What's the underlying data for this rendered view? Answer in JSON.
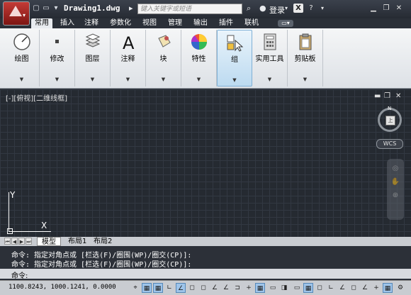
{
  "title_bar": {
    "document_title": "Drawing1.dwg",
    "search_placeholder": "键入关键字或短语",
    "login_label": "登录",
    "exchange_label": "X",
    "help_label": "?"
  },
  "ribbon_tabs": [
    "常用",
    "插入",
    "注释",
    "参数化",
    "视图",
    "管理",
    "输出",
    "插件",
    "联机"
  ],
  "active_tab": "常用",
  "ribbon_panels": [
    {
      "label": "绘图",
      "icon": "draw-circle-icon"
    },
    {
      "label": "修改",
      "icon": "modify-icon"
    },
    {
      "label": "图层",
      "icon": "layers-icon"
    },
    {
      "label": "注释",
      "icon": "annotation-text-icon"
    },
    {
      "label": "块",
      "icon": "block-icon"
    },
    {
      "label": "特性",
      "icon": "properties-color-wheel-icon"
    },
    {
      "label": "组",
      "icon": "group-icon"
    },
    {
      "label": "实用工具",
      "icon": "calculator-icon"
    },
    {
      "label": "剪贴板",
      "icon": "clipboard-icon"
    }
  ],
  "viewport": {
    "label": "[-][俯视][二维线框]",
    "compass_top": "上",
    "compass_north": "N",
    "wcs_label": "WCS",
    "ucs_x_label": "X",
    "ucs_y_label": "Y"
  },
  "layout_tabs": [
    "模型",
    "布局1",
    "布局2"
  ],
  "active_layout_tab": "模型",
  "command_history": [
    "命令: 指定对角点或 [栏选(F)/圈围(WP)/圈交(CP)]:",
    "命令: 指定对角点或 [栏选(F)/圈围(WP)/圈交(CP)]:"
  ],
  "command_prompt": "命令:",
  "status_bar": {
    "coordinates": "1100.8243, 1000.1241, 0.0000"
  },
  "colors": {
    "titlebar": "#2f343c",
    "ribbon": "#e8ebef",
    "viewport_bg": "#252a31",
    "grid_line": "#323842",
    "accent_red": "#b52a25",
    "highlight_blue": "#bcdaf0"
  }
}
